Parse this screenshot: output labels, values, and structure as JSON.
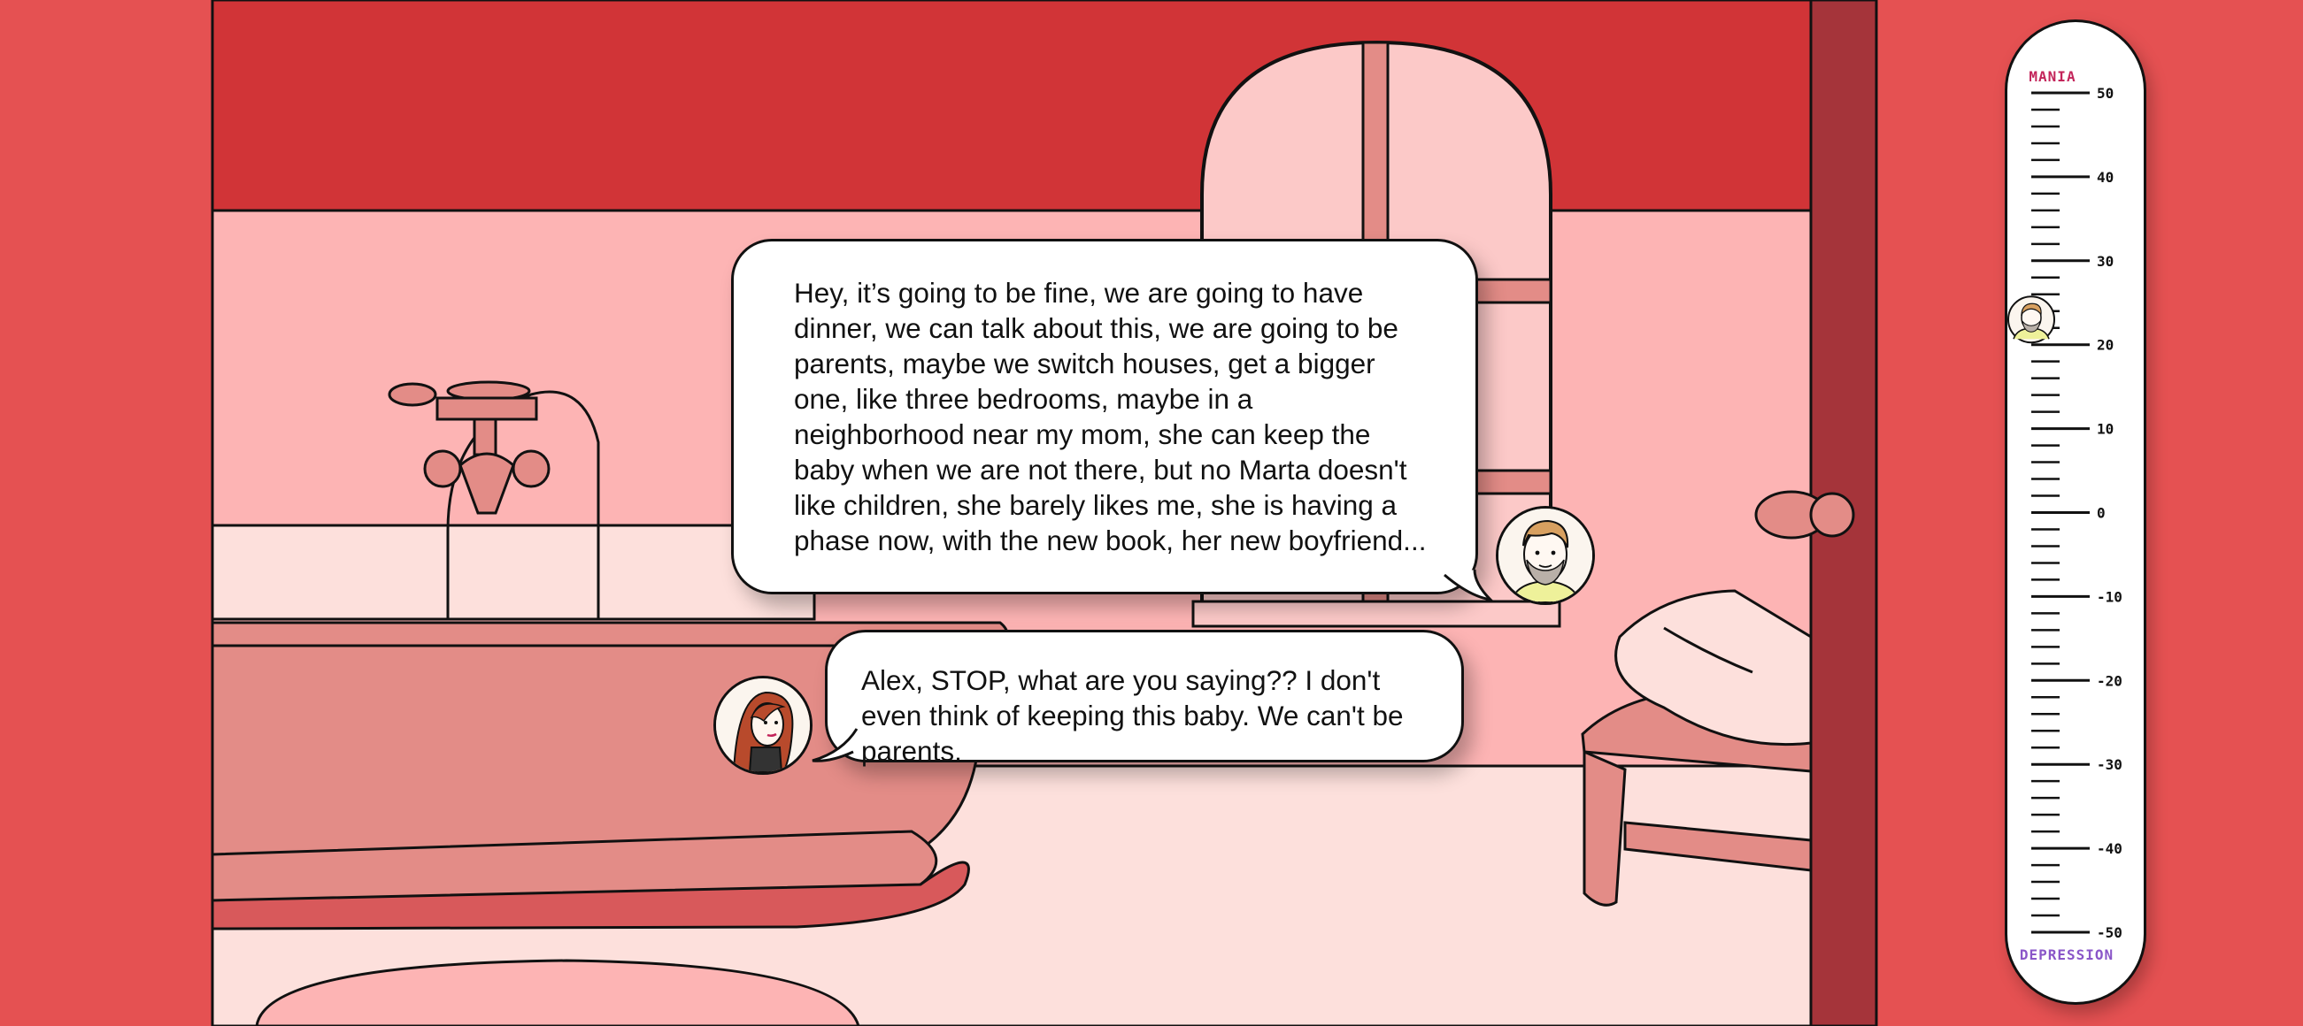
{
  "dialogue": {
    "alex": {
      "speaker_icon": "bearded-man-avatar",
      "text": "Hey, it’s going to be fine, we are going to have dinner, we can talk about this, we are going to be parents, maybe we switch houses, get a bigger one, like three bedrooms, maybe in a neighborhood near my mom, she can keep the baby when we are not there, but no Marta doesn't like children, she barely likes me, she is having a phase now, with the new book, her new boyfriend..."
    },
    "marta": {
      "speaker_icon": "red-haired-woman-avatar",
      "text": "Alex, STOP, what are you saying?? I don't even think of keeping this baby. We can't be parents."
    }
  },
  "mood_meter": {
    "top_label": "MANIA",
    "bottom_label": "DEPRESSION",
    "tick_labels": [
      "50",
      "40",
      "30",
      "20",
      "10",
      "0",
      "-10",
      "-20",
      "-30",
      "-40",
      "-50"
    ],
    "current_value": 23,
    "marker_icon": "bearded-man-avatar",
    "top_label_color": "#c3245a",
    "bottom_label_color": "#8a56c8"
  },
  "colors": {
    "background": "#e55152",
    "ceiling": "#d13437",
    "wall": "#fdb4b4",
    "wall_lower": "#fde0dc",
    "tub": "#e38c87",
    "door_frame": "#a5343a"
  }
}
